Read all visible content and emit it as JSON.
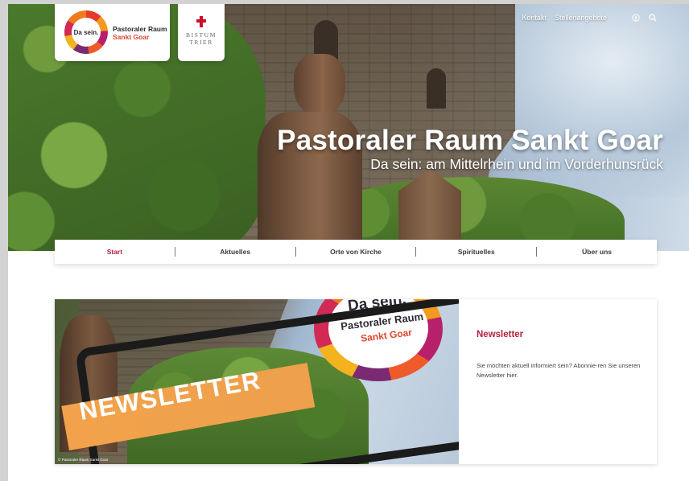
{
  "top_links": {
    "contact": "Kontakt",
    "jobs": "Stellenangebote",
    "accessibility_icon": "accessibility-icon",
    "search_icon": "search-icon"
  },
  "logo": {
    "ring_text": "Da sein.",
    "line1": "Pastoraler Raum",
    "line2": "Sankt Goar",
    "brand_colors": [
      "#e43a2a",
      "#f29a1f",
      "#b7206a",
      "#7a2a72"
    ]
  },
  "bistum": {
    "line1": "BISTUM",
    "line2": "TRIER",
    "cross_color": "#c8102e"
  },
  "hero": {
    "title": "Pastoraler Raum Sankt Goar",
    "subtitle": "Da sein: am Mittelrhein und im Vorderhunsrück"
  },
  "nav": {
    "items": [
      {
        "label": "Start",
        "active": true
      },
      {
        "label": "Aktuelles",
        "active": false
      },
      {
        "label": "Orte von Kirche",
        "active": false
      },
      {
        "label": "Spirituelles",
        "active": false
      },
      {
        "label": "Über uns",
        "active": false
      }
    ],
    "accent_color": "#b2233e"
  },
  "newsletter": {
    "image_headline_1": "Da sein.",
    "image_headline_2": "Pastoraler Raum",
    "image_headline_3": "Sankt Goar",
    "banner_text": "NEWSLETTER",
    "image_credit": "© Pastoraler Raum Sankt Goar",
    "title": "Newsletter",
    "text": "Sie möchten aktuell informiert sein? Abonnie-ren Sie unseren Newsletter hier."
  }
}
